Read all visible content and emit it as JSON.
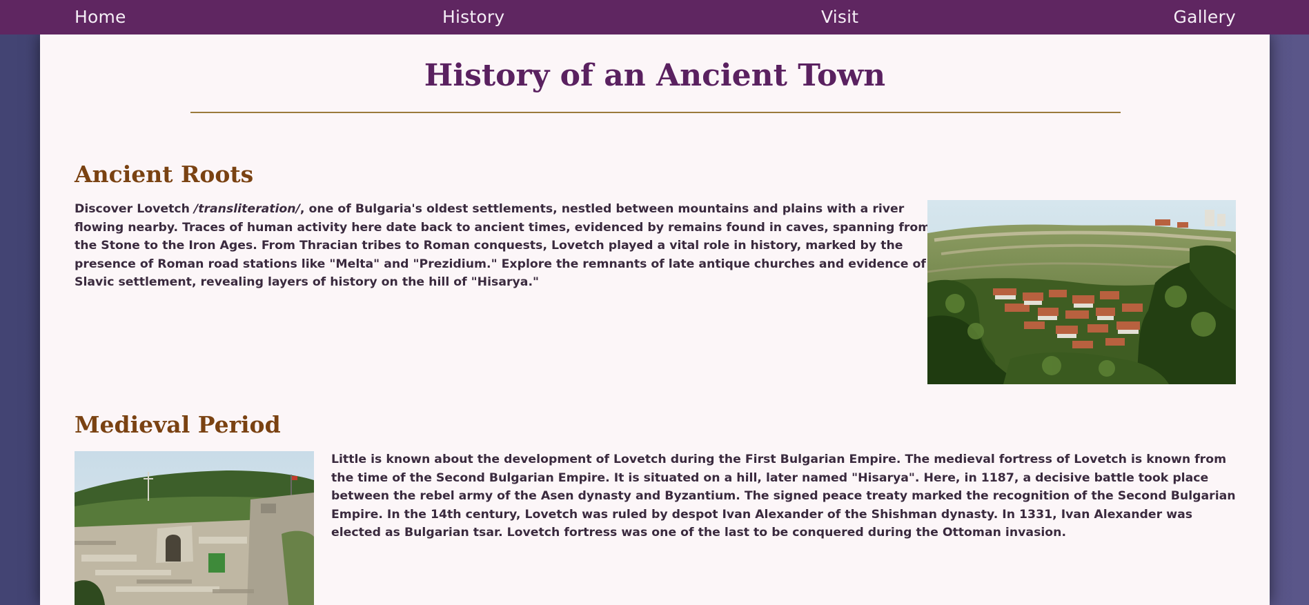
{
  "nav": {
    "items": [
      {
        "label": "Home"
      },
      {
        "label": "History"
      },
      {
        "label": "Visit"
      },
      {
        "label": "Gallery"
      }
    ]
  },
  "page": {
    "title": "History of an Ancient Town"
  },
  "sections": [
    {
      "heading": "Ancient Roots",
      "text_before": "Discover Lovetch ",
      "emphasis": "/transliteration/",
      "text_after": ", one of Bulgaria's oldest settlements, nestled between mountains and plains with a river flowing nearby. Traces of human activity here date back to ancient times, evidenced by remains found in caves, spanning from the Stone to the Iron Ages. From Thracian tribes to Roman conquests, Lovetch played a vital role in history, marked by the presence of Roman road stations like \"Melta\" and \"Prezidium.\" Explore the remnants of late antique churches and evidence of Slavic settlement, revealing layers of history on the hill of \"Hisarya.\"",
      "image": "town-hillside-photo"
    },
    {
      "heading": "Medieval Period",
      "text": "Little is known about the development of Lovetch during the First Bulgarian Empire. The medieval fortress of Lovetch is known from the time of the Second Bulgarian Empire. It is situated on a hill, later named \"Hisarya\". Here, in 1187, a decisive battle took place between the rebel army of the Asen dynasty and Byzantium. The signed peace treaty marked the recognition of the Second Bulgarian Empire. In the 14th century, Lovetch was ruled by despot Ivan Alexander of the Shishman dynasty. In 1331, Ivan Alexander was elected as Bulgarian tsar. Lovetch fortress was one of the last to be conquered during the Ottoman invasion.",
      "image": "fortress-ruins-photo"
    }
  ],
  "colors": {
    "nav_bg": "#5f2661",
    "title": "#5a2160",
    "heading": "#7a4212",
    "rule": "#9b7a3c",
    "body_text": "#3a2a3e",
    "page_bg": "#fcf6f8"
  }
}
